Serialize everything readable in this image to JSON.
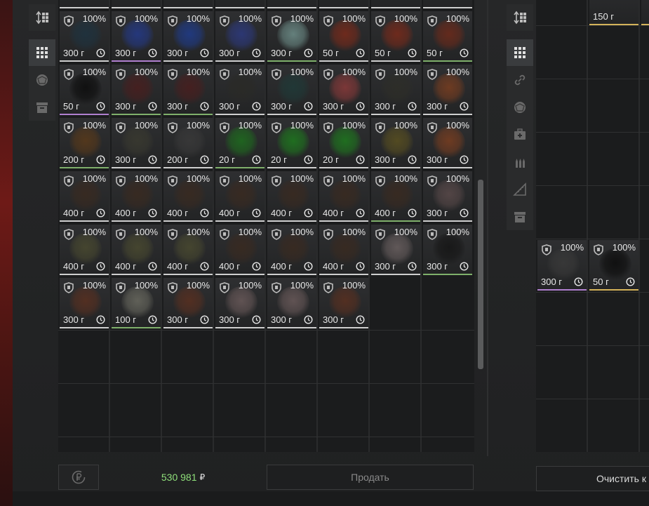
{
  "left_sidebar": {
    "sort_icon": "sort-icon",
    "items": [
      {
        "name": "all-items",
        "icon": "grid-icon",
        "active": true
      },
      {
        "name": "artifacts",
        "icon": "artifact-icon",
        "active": false
      },
      {
        "name": "other",
        "icon": "box-icon",
        "active": false
      }
    ]
  },
  "right_sidebar": {
    "sort_icon": "sort-icon",
    "items": [
      {
        "name": "all-items",
        "icon": "grid-icon",
        "active": true
      },
      {
        "name": "attachments",
        "icon": "link-icon",
        "active": false
      },
      {
        "name": "artifacts",
        "icon": "artifact-icon",
        "active": false
      },
      {
        "name": "medicine",
        "icon": "medkit-icon",
        "active": false
      },
      {
        "name": "ammo",
        "icon": "ammo-icon",
        "active": false
      },
      {
        "name": "tools",
        "icon": "ruler-icon",
        "active": false
      },
      {
        "name": "other",
        "icon": "box-icon",
        "active": false
      }
    ]
  },
  "inventory": {
    "columns": 8,
    "rows": [
      [
        {
          "pct": "100%",
          "price": "300 г",
          "color": "#1e3340",
          "border": "w"
        },
        {
          "pct": "100%",
          "price": "300 г",
          "color": "#243a8a",
          "border": "p"
        },
        {
          "pct": "100%",
          "price": "300 г",
          "color": "#1f3c8c",
          "border": "w"
        },
        {
          "pct": "100%",
          "price": "300 г",
          "color": "#2d3a80",
          "border": "w"
        },
        {
          "pct": "100%",
          "price": "300 г",
          "color": "#6f8f8a",
          "border": "g"
        },
        {
          "pct": "100%",
          "price": "50 г",
          "color": "#7a2a1a",
          "border": "w"
        },
        {
          "pct": "100%",
          "price": "50 г",
          "color": "#7a2a1a",
          "border": "w"
        },
        {
          "pct": "100%",
          "price": "50 г",
          "color": "#6e2a1a",
          "border": "g"
        }
      ],
      [
        {
          "pct": "100%",
          "price": "50 г",
          "color": "#0c0c0c",
          "border": "p"
        },
        {
          "pct": "100%",
          "price": "300 г",
          "color": "#4a1e1e",
          "border": "g"
        },
        {
          "pct": "100%",
          "price": "300 г",
          "color": "#4a1e1e",
          "border": "g"
        },
        {
          "pct": "100%",
          "price": "300 г",
          "color": "#2a2a26",
          "border": "w"
        },
        {
          "pct": "100%",
          "price": "300 г",
          "color": "#1f3a38",
          "border": "w"
        },
        {
          "pct": "100%",
          "price": "300 г",
          "color": "#8a3a3a",
          "border": "w"
        },
        {
          "pct": "100%",
          "price": "300 г",
          "color": "#2e2e28",
          "border": "w"
        },
        {
          "pct": "100%",
          "price": "300 г",
          "color": "#7a3e20",
          "border": "w"
        }
      ],
      [
        {
          "pct": "100%",
          "price": "200 г",
          "color": "#5a3a1a",
          "border": "g"
        },
        {
          "pct": "100%",
          "price": "300 г",
          "color": "#3a3a30",
          "border": "w"
        },
        {
          "pct": "100%",
          "price": "200 г",
          "color": "#3a3a3a",
          "border": "w"
        },
        {
          "pct": "100%",
          "price": "20 г",
          "color": "#1e6e1e",
          "border": "g"
        },
        {
          "pct": "100%",
          "price": "20 г",
          "color": "#1e7a1e",
          "border": "w"
        },
        {
          "pct": "100%",
          "price": "20 г",
          "color": "#1e7a1e",
          "border": "w"
        },
        {
          "pct": "100%",
          "price": "300 г",
          "color": "#5a5020",
          "border": "w"
        },
        {
          "pct": "100%",
          "price": "300 г",
          "color": "#7a3e20",
          "border": "w"
        }
      ],
      [
        {
          "pct": "100%",
          "price": "400 г",
          "color": "#3a2a20",
          "border": "w"
        },
        {
          "pct": "100%",
          "price": "400 г",
          "color": "#3a2a20",
          "border": "w"
        },
        {
          "pct": "100%",
          "price": "400 г",
          "color": "#3a2a20",
          "border": "w"
        },
        {
          "pct": "100%",
          "price": "400 г",
          "color": "#3a2a20",
          "border": "w"
        },
        {
          "pct": "100%",
          "price": "400 г",
          "color": "#3a2a20",
          "border": "w"
        },
        {
          "pct": "100%",
          "price": "400 г",
          "color": "#3a2a20",
          "border": "w"
        },
        {
          "pct": "100%",
          "price": "400 г",
          "color": "#3a2a20",
          "border": "g"
        },
        {
          "pct": "100%",
          "price": "300 г",
          "color": "#5a4a4a",
          "border": "w"
        }
      ],
      [
        {
          "pct": "100%",
          "price": "400 г",
          "color": "#4a4a30",
          "border": "w"
        },
        {
          "pct": "100%",
          "price": "400 г",
          "color": "#4a4a30",
          "border": "w"
        },
        {
          "pct": "100%",
          "price": "400 г",
          "color": "#4a4a30",
          "border": "w"
        },
        {
          "pct": "100%",
          "price": "400 г",
          "color": "#3a2a20",
          "border": "w"
        },
        {
          "pct": "100%",
          "price": "400 г",
          "color": "#3a2a20",
          "border": "w"
        },
        {
          "pct": "100%",
          "price": "400 г",
          "color": "#3a2a20",
          "border": "w"
        },
        {
          "pct": "100%",
          "price": "300 г",
          "color": "#6a6060",
          "border": "w"
        },
        {
          "pct": "100%",
          "price": "300 г",
          "color": "#151515",
          "border": "g"
        }
      ],
      [
        {
          "pct": "100%",
          "price": "300 г",
          "color": "#5a3020",
          "border": "w"
        },
        {
          "pct": "100%",
          "price": "100 г",
          "color": "#6a6a60",
          "border": "g"
        },
        {
          "pct": "100%",
          "price": "300 г",
          "color": "#5a3020",
          "border": "w"
        },
        {
          "pct": "100%",
          "price": "300 г",
          "color": "#6a5a5a",
          "border": "w"
        },
        {
          "pct": "100%",
          "price": "300 г",
          "color": "#6a5a5a",
          "border": "w"
        },
        {
          "pct": "100%",
          "price": "300 г",
          "color": "#5a3020",
          "border": "w"
        }
      ]
    ]
  },
  "right_panel": {
    "top_partial_price": "150 г",
    "items": [
      {
        "pct": "100%",
        "price": "300 г",
        "color": "#3a3a3a",
        "border": "p"
      },
      {
        "pct": "100%",
        "price": "50 г",
        "color": "#0c0c0c",
        "border": "y"
      }
    ]
  },
  "footer": {
    "balance": "530 981",
    "currency": "₽",
    "sell_label": "Продать",
    "clear_label": "Очистить к"
  }
}
